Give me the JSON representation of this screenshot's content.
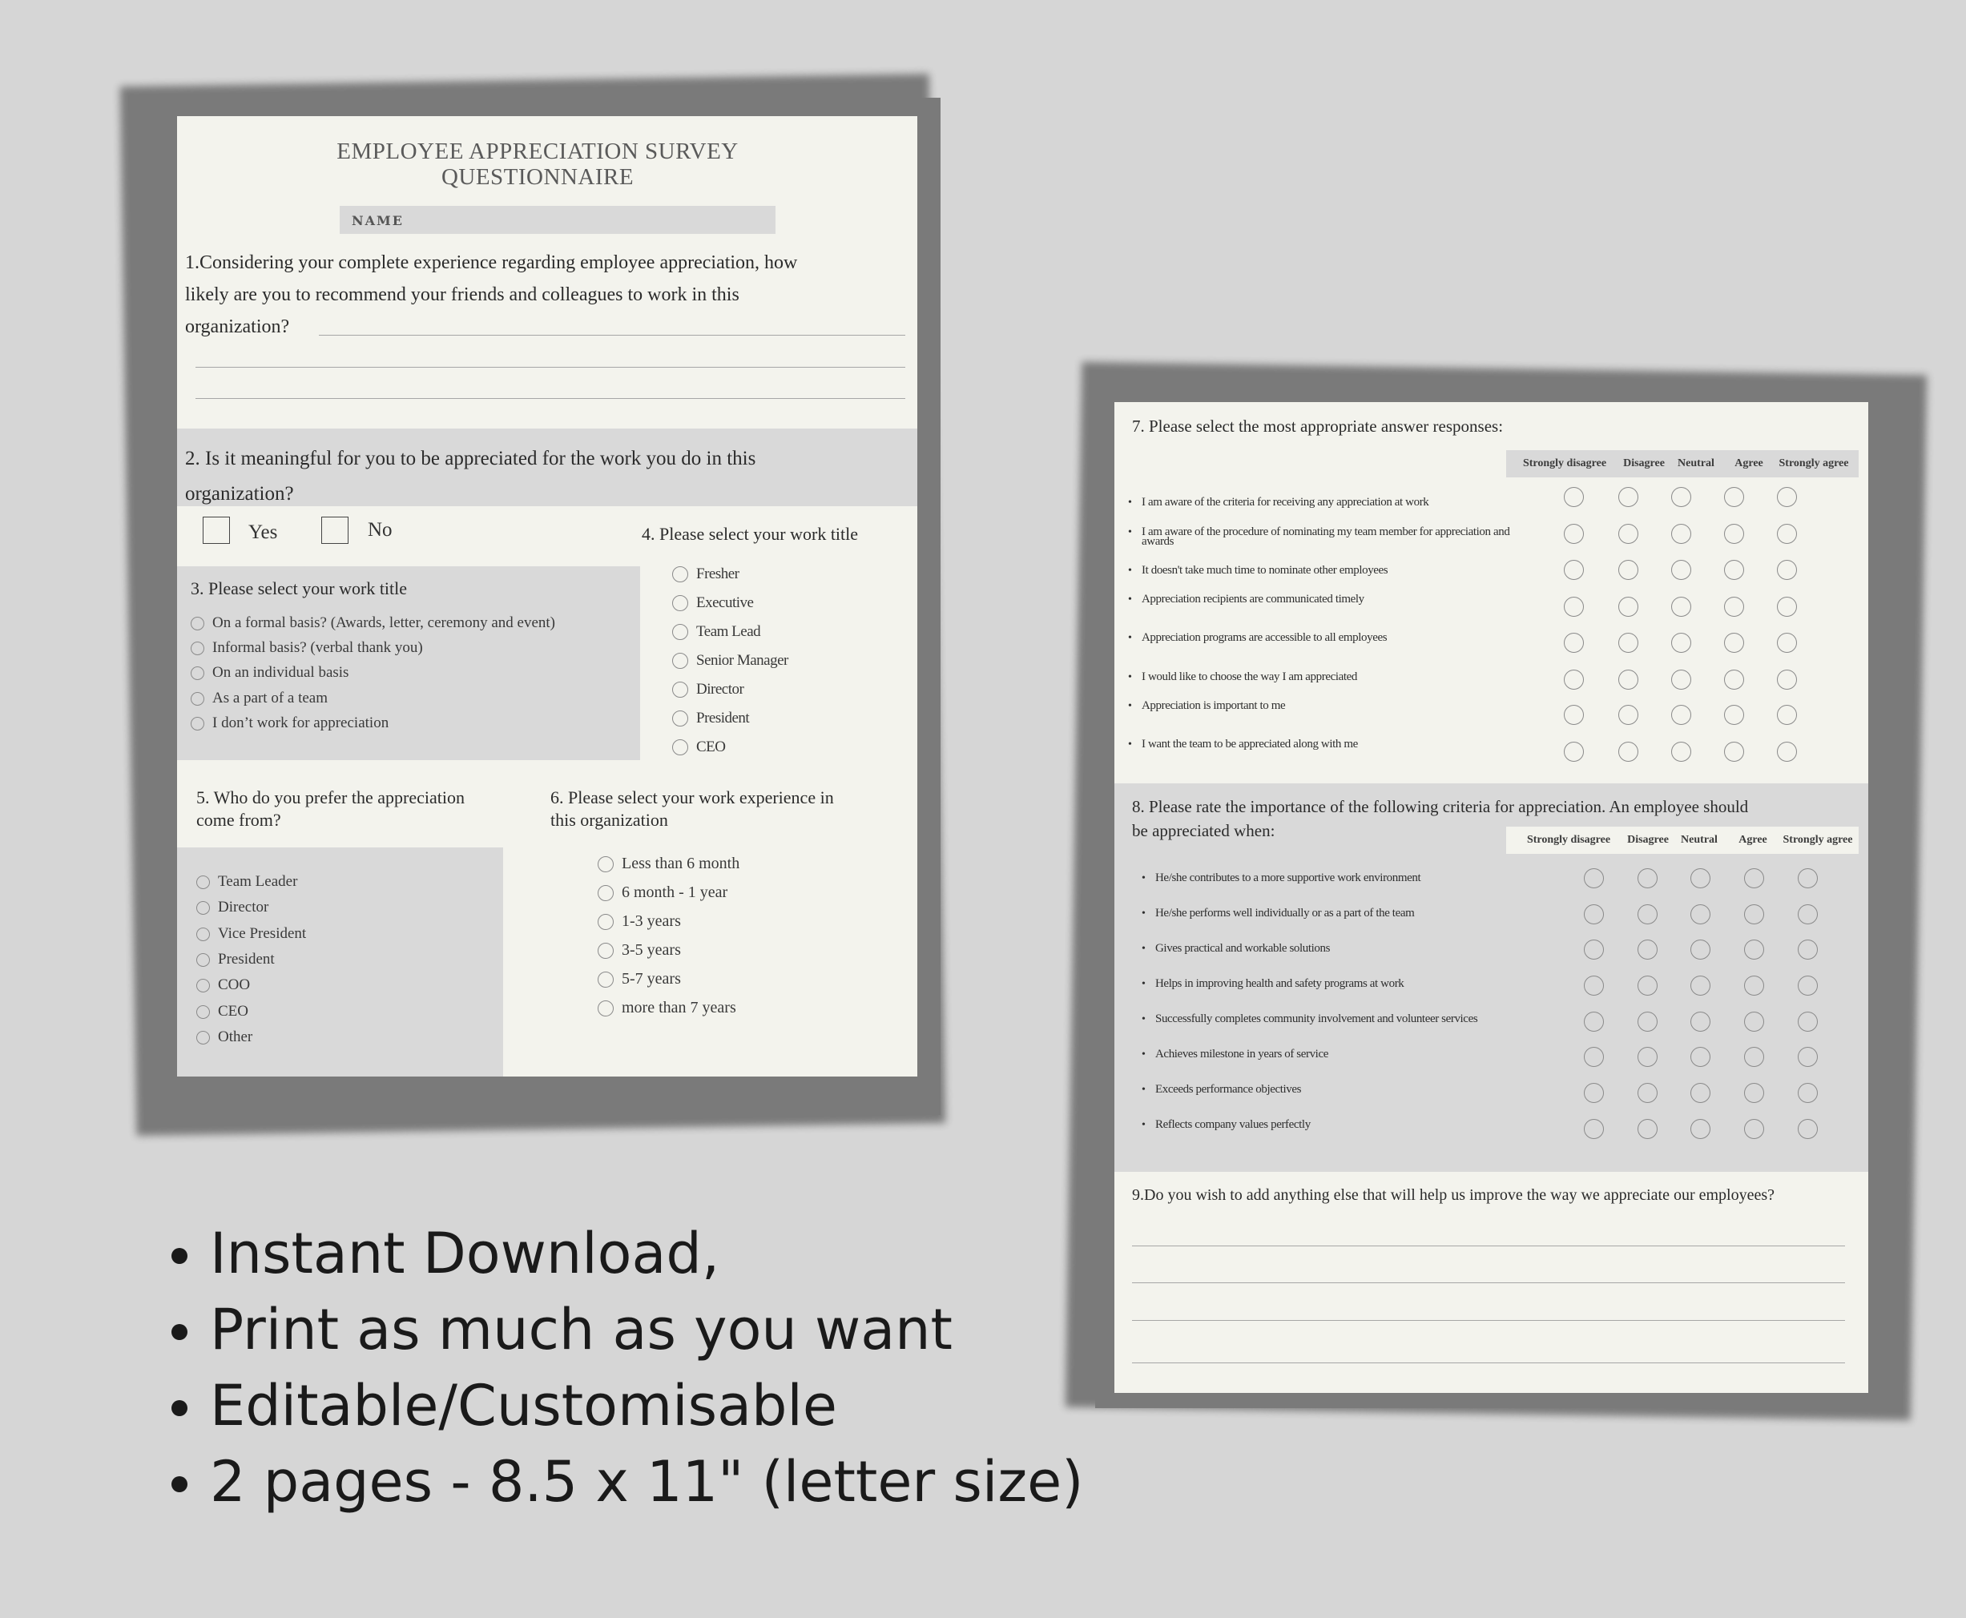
{
  "page1": {
    "title_line1": "EMPLOYEE APPRECIATION SURVEY",
    "title_line2": "QUESTIONNAIRE",
    "name_label": "NAME",
    "q1_line1": "1.Considering your complete experience regarding employee appreciation, how",
    "q1_line2": "likely are you to recommend your friends and colleagues to work in this",
    "q1_line3": "organization?",
    "q2_line1": "2. Is it meaningful for you to be appreciated for the work you do in this",
    "q2_line2": "organization?",
    "yes_label": "Yes",
    "no_label": "No",
    "q3_title": "3. Please select your work title",
    "q3_options": [
      "On a formal basis? (Awards, letter, ceremony and event)",
      "Informal basis? (verbal thank you)",
      "On an individual basis",
      "As a part of a team",
      "I don’t work for appreciation"
    ],
    "q4_title": "4. Please select your work title",
    "q4_options": [
      "Fresher",
      "Executive",
      "Team Lead",
      "Senior Manager",
      "Director",
      "President",
      "CEO"
    ],
    "q5_line1": "5. Who do you prefer the appreciation",
    "q5_line2": "come from?",
    "q5_options": [
      "Team Leader",
      "Director",
      "Vice President",
      "President",
      "COO",
      "CEO",
      "Other"
    ],
    "q6_line1": "6. Please select your work experience in",
    "q6_line2": "this organization",
    "q6_options": [
      "Less than 6 month",
      "6 month - 1 year",
      "1-3 years",
      "3-5 years",
      "5-7 years",
      "more than 7 years"
    ]
  },
  "page2": {
    "q7_title": "7. Please select the most appropriate answer responses:",
    "scale": [
      "Strongly disagree",
      "Disagree",
      "Neutral",
      "Agree",
      "Strongly agree"
    ],
    "q7_items": [
      "I am aware of the criteria for receiving any appreciation at work",
      "I am aware of the procedure of nominating my team member for appreciation and",
      "It doesn't take much time to nominate other employees",
      "Appreciation recipients are communicated timely",
      "Appreciation programs are accessible to all employees",
      "I would like to choose the way I am appreciated",
      "Appreciation is important to me",
      "I want the team to be appreciated along with me"
    ],
    "q7_item2_cont": "awards",
    "q8_line1": "8. Please rate the importance of the following criteria for appreciation. An employee should",
    "q8_line2": "be appreciated when:",
    "q8_items": [
      "He/she contributes to a more supportive work environment",
      "He/she performs well individually or as a part of the team",
      "Gives practical and workable solutions",
      "Helps in improving health and safety programs at work",
      "Successfully completes community involvement and volunteer services",
      "Achieves milestone in years of service",
      "Exceeds performance objectives",
      "Reflects company values perfectly"
    ],
    "q9_title": "9.Do you wish to add anything else that will help us improve the way we appreciate our employees?"
  },
  "features": [
    "Instant Download,",
    "Print as much as you want",
    "Editable/Customisable",
    "2 pages  - 8.5 x 11\" (letter size)"
  ]
}
